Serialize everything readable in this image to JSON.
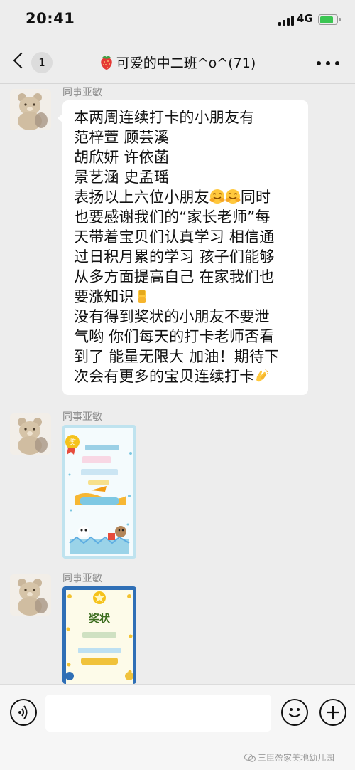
{
  "status_bar": {
    "time": "20:41",
    "network": "4G",
    "battery_level": 0.8,
    "battery_color": "#3bc552"
  },
  "nav": {
    "back_icon": "chevron-left-icon",
    "unread_count": "1",
    "title_icon": "strawberry-icon",
    "title": "可爱的中二班^o^(71)",
    "more_icon": "more-dots-icon"
  },
  "messages": [
    {
      "type": "text",
      "sender": "同事亚敏",
      "lines": [
        "本两周连续打卡的小朋友有",
        "范梓萱 顾芸溪",
        "胡欣妍 许依菡",
        "景艺涵 史孟瑶",
        "表扬以上六位小朋友",
        "同时",
        "也要感谢我们的“家长老师”每",
        "天带着宝贝们认真学习 相信通",
        "过日积月累的学习 孩子们能够",
        "从多方面提高自己 在家我们也",
        "要涨知识",
        "没有得到奖状的小朋友不要泄",
        "气哟 你们每天的打卡老师否看",
        "到了 能量无限大 加油！期待下",
        "次会有更多的宝贝连续打卡"
      ],
      "emojis": [
        "hugging-face-icon",
        "raised-fist-icon",
        "clapping-hands-icon"
      ]
    },
    {
      "type": "image",
      "sender": "同事亚敏",
      "image": "certificate-image"
    },
    {
      "type": "image",
      "sender": "同事亚敏",
      "image": "award-certificate-image",
      "text": "奖状"
    }
  ],
  "input_bar": {
    "voice_icon": "voice-icon",
    "input_value": "",
    "emoji_icon": "smiley-icon",
    "plus_icon": "plus-icon"
  },
  "watermark": "三臣盈家美地幼儿园"
}
